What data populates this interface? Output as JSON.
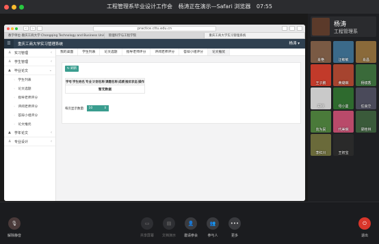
{
  "window": {
    "title": "工程管理系毕业设计工作会",
    "presenting": "杨涛正在演示—Safari 浏览器",
    "time": "07:55"
  },
  "browser": {
    "url": "practice.cttu.edu.cn",
    "tabs": [
      "教学单位-重庆工商大学 Chongqing Technology and Business University",
      "管理科学与工程学院",
      "重庆工商大学实习管理系统"
    ]
  },
  "app": {
    "title": "重庆工商大学实习管理系统",
    "user": "杨涛",
    "sidebar": [
      {
        "label": "实习管理",
        "type": "group",
        "icon": "user-icon"
      },
      {
        "label": "学生管理",
        "type": "group",
        "icon": "user-icon"
      },
      {
        "label": "毕业论文",
        "type": "group",
        "icon": "graduation-icon",
        "expanded": true
      },
      {
        "label": "学生列表",
        "type": "sub"
      },
      {
        "label": "论文选题",
        "type": "sub"
      },
      {
        "label": "指导老师评分",
        "type": "sub"
      },
      {
        "label": "评阅老师评分",
        "type": "sub"
      },
      {
        "label": "答辩小组评分",
        "type": "sub"
      },
      {
        "label": "论文推优",
        "type": "sub"
      },
      {
        "label": "学年论文",
        "type": "group",
        "icon": "graduation-icon"
      },
      {
        "label": "专业设计",
        "type": "group",
        "icon": "user-icon"
      }
    ],
    "tabs": [
      "我的桌面",
      "学生列表",
      "论文选题",
      "指导老师评分",
      "评阅老师评分",
      "答辩小组评分",
      "论文推优"
    ],
    "refresh_label": "刷新",
    "table": {
      "headers": [
        "学号",
        "学生姓名",
        "专业",
        "计划名称",
        "课题名称",
        "成绩",
        "推优状态",
        "操作"
      ],
      "empty": "暂无数据"
    },
    "pager": {
      "label": "每页显示数量:",
      "value": "10"
    }
  },
  "meeting": {
    "host": {
      "name": "杨涛",
      "role": "工程管理系"
    },
    "participants": [
      {
        "name": "肖艳",
        "color": "#7a5a44"
      },
      {
        "name": "汪敏敏",
        "color": "#3b6a8a"
      },
      {
        "name": "肖昌",
        "color": "#8a6a3a"
      },
      {
        "name": "王子鹏",
        "color": "#c23a2a"
      },
      {
        "name": "黄璐琳",
        "color": "#a6442f"
      },
      {
        "name": "杨镜香",
        "color": "#3a6a3a"
      },
      {
        "name": "郑欢",
        "color": "#c9c9c9"
      },
      {
        "name": "母小曼",
        "color": "#2e6a2e"
      },
      {
        "name": "任良华",
        "color": "#4a4a5a"
      },
      {
        "name": "向为民",
        "color": "#4a7a3a"
      },
      {
        "name": "代美琳",
        "color": "#b94a6a"
      },
      {
        "name": "梁桂林",
        "color": "#3a5a3a"
      },
      {
        "name": "李红川",
        "color": "#6a6a3a"
      },
      {
        "name": "王初宝",
        "color": "#2a2a2a"
      }
    ]
  },
  "bottom": {
    "mute": "解除静音",
    "share": "共享屏幕",
    "docs": "文档演示",
    "invite": "邀请参会",
    "participants": "参与人",
    "more": "更多",
    "leave": "退出"
  }
}
